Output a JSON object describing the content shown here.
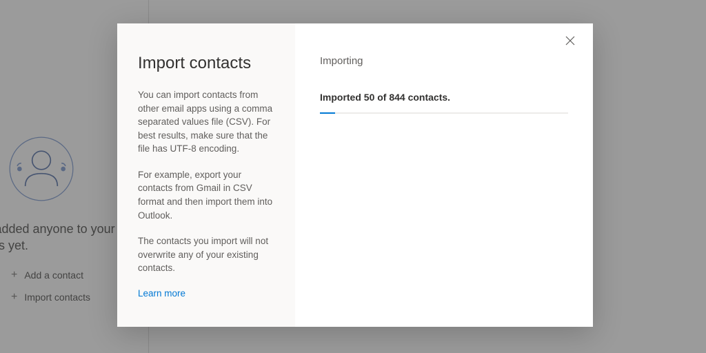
{
  "background": {
    "empty_heading": "nven't added anyone to your contacts yet.",
    "add_contact_label": "Add a contact",
    "import_contacts_label": "Import contacts"
  },
  "modal": {
    "title": "Import contacts",
    "para1": "You can import contacts from other email apps using a comma separated values file (CSV). For best results, make sure that the file has UTF-8 encoding.",
    "para2": "For example, export your contacts from Gmail in CSV format and then import them into Outlook.",
    "para3": "The contacts you import will not overwrite any of your existing contacts.",
    "learn_more": "Learn more",
    "right_heading": "Importing",
    "status": "Imported 50 of 844 contacts.",
    "progress_percent": 6
  },
  "colors": {
    "accent": "#0078d4"
  }
}
